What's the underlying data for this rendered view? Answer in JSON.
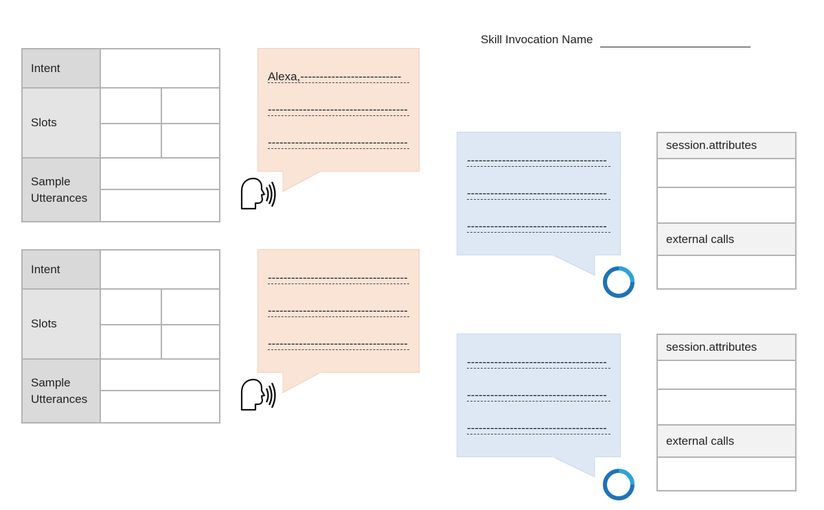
{
  "header": {
    "invocation_label": "Skill Invocation Name"
  },
  "intent_cards": [
    {
      "intent_label": "Intent",
      "slots_label": "Slots",
      "sample_label_line1": "Sample",
      "sample_label_line2": "Utterances"
    },
    {
      "intent_label": "Intent",
      "slots_label": "Slots",
      "sample_label_line1": "Sample",
      "sample_label_line2": "Utterances"
    }
  ],
  "user_bubbles": [
    {
      "lines": [
        "Alexa,--------------------------",
        "------------------------------------",
        "------------------------------------"
      ]
    },
    {
      "lines": [
        "------------------------------------",
        "------------------------------------",
        "------------------------------------"
      ]
    }
  ],
  "alexa_bubbles": [
    {
      "lines": [
        "------------------------------------",
        "------------------------------------",
        "------------------------------------"
      ]
    },
    {
      "lines": [
        "------------------------------------",
        "------------------------------------",
        "------------------------------------"
      ]
    }
  ],
  "state_cards": [
    {
      "session_label": "session.attributes",
      "external_label": "external calls"
    },
    {
      "session_label": "session.attributes",
      "external_label": "external calls"
    }
  ],
  "colors": {
    "user_bubble": "#fae4d6",
    "alexa_bubble": "#dde8f4",
    "header_cell": "#d9d9d9",
    "border": "#b3b3b3",
    "ring": "#1f72b8"
  },
  "icons": {
    "speaker": "speaking-head-icon",
    "alexa": "alexa-ring-icon"
  }
}
